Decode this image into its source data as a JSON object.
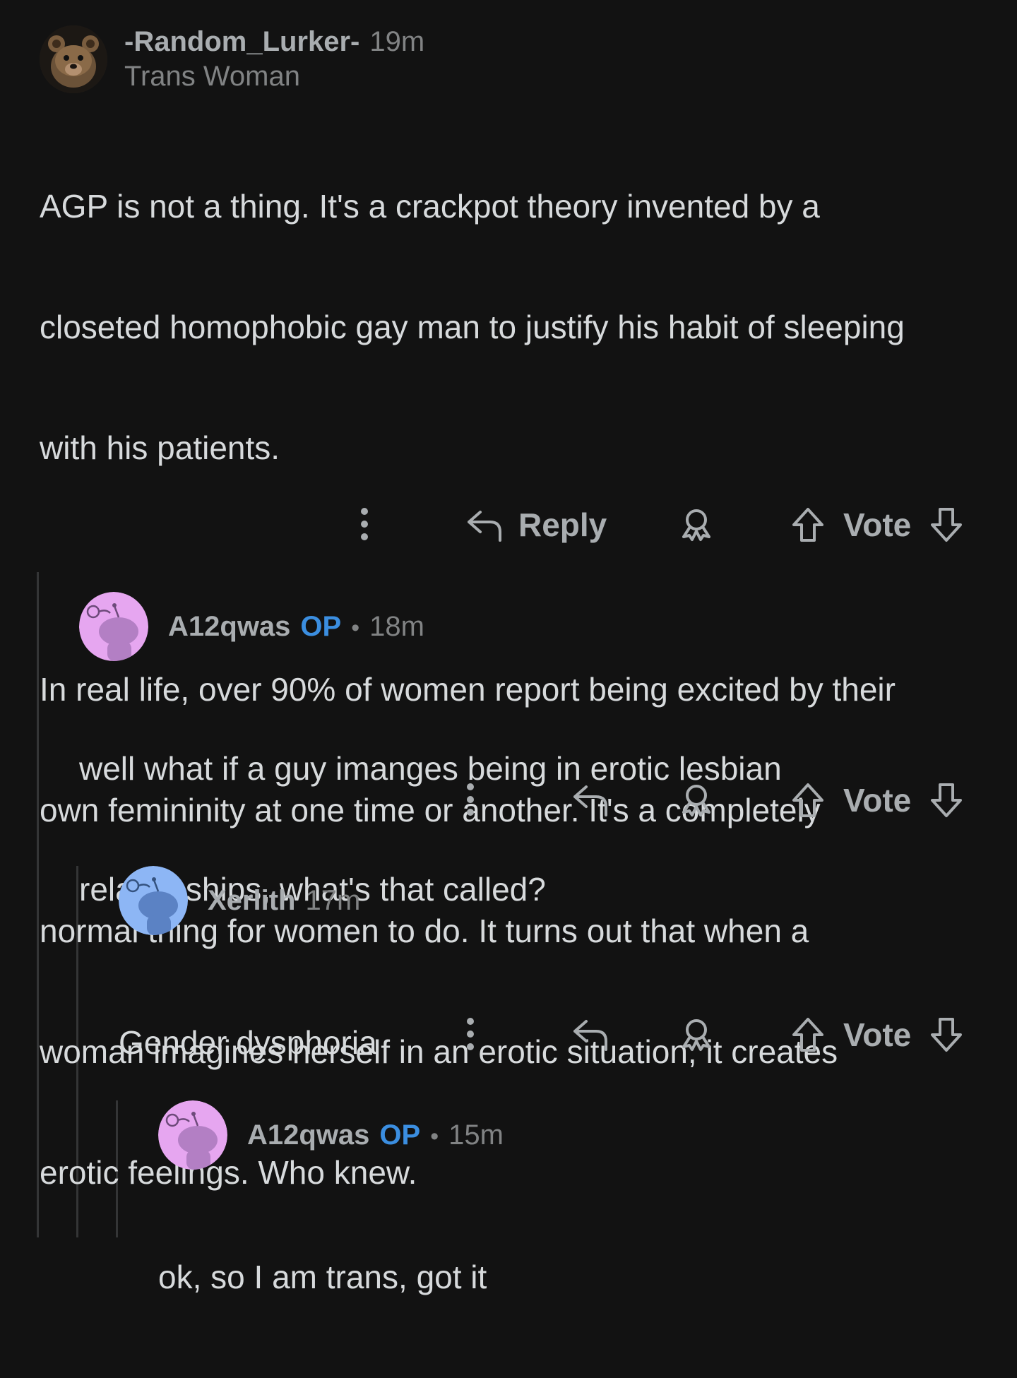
{
  "comments": [
    {
      "username": "-Random_Lurker-",
      "time": "19m",
      "flair": "Trans Woman",
      "body": [
        "AGP is not a thing. It's a crackpot theory invented by a",
        "closeted homophobic gay man to justify his habit of sleeping",
        "with his patients.",
        "",
        "In real life, over 90% of women report being excited by their",
        "own femininity at one time or another. It's a completely",
        "normal thing for women to do. It turns out that when a",
        "woman imagines herself in an erotic situation, it creates",
        "erotic feelings. Who knew."
      ],
      "actions": {
        "reply_label": "Reply",
        "vote_label": "Vote"
      }
    },
    {
      "username": "A12qwas",
      "op_badge": "OP",
      "separator": "•",
      "time": "18m",
      "body": [
        "well what if a guy imanges being in erotic lesbian",
        "relationships, what's that called?"
      ],
      "avatar_color": "#e6a6f0",
      "actions": {
        "vote_label": "Vote"
      }
    },
    {
      "username": "Xerlith",
      "time": "17m",
      "body": [
        "Gender dysphoria"
      ],
      "avatar_color": "#8db6f5",
      "actions": {
        "vote_label": "Vote"
      }
    },
    {
      "username": "A12qwas",
      "op_badge": "OP",
      "separator": "•",
      "time": "15m",
      "body": [
        "ok, so I am trans, got it"
      ],
      "avatar_color": "#e6a6f0"
    }
  ],
  "icons": {
    "more": "more-options-icon",
    "reply": "reply-arrow-icon",
    "award": "award-icon",
    "upvote": "upvote-arrow-icon",
    "downvote": "downvote-arrow-icon"
  },
  "colors": {
    "background": "#121212",
    "text": "#d7dadc",
    "muted": "#818384",
    "op_badge": "#3b8ee0",
    "thread_line": "#343536"
  }
}
